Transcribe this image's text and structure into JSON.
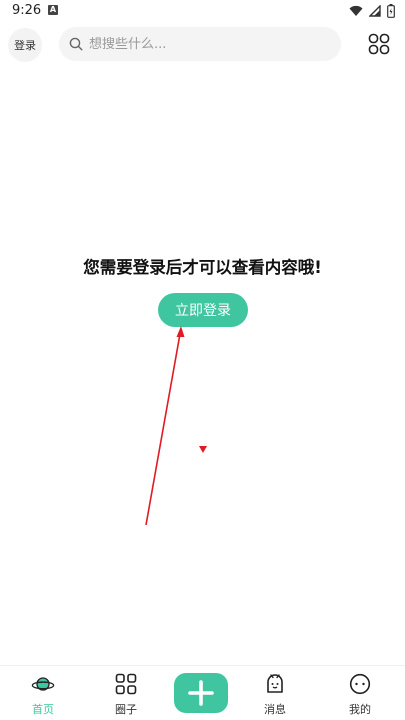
{
  "status_bar": {
    "time": "9:26",
    "notification_letter": "A"
  },
  "header": {
    "login_label": "登录",
    "search_placeholder": "想搜些什么..."
  },
  "main": {
    "prompt_text": "您需要登录后才可以查看内容哦!",
    "login_button_label": "立即登录"
  },
  "bottom_nav": {
    "items": [
      {
        "label": "首页",
        "icon": "planet-icon",
        "active": true
      },
      {
        "label": "圈子",
        "icon": "grid-icon",
        "active": false
      },
      {
        "label": "",
        "icon": "plus-icon",
        "active": false
      },
      {
        "label": "消息",
        "icon": "bell-face-icon",
        "active": false
      },
      {
        "label": "我的",
        "icon": "smiley-icon",
        "active": false
      }
    ]
  },
  "colors": {
    "accent": "#3fc6a0",
    "annotation": "#e01b24"
  }
}
